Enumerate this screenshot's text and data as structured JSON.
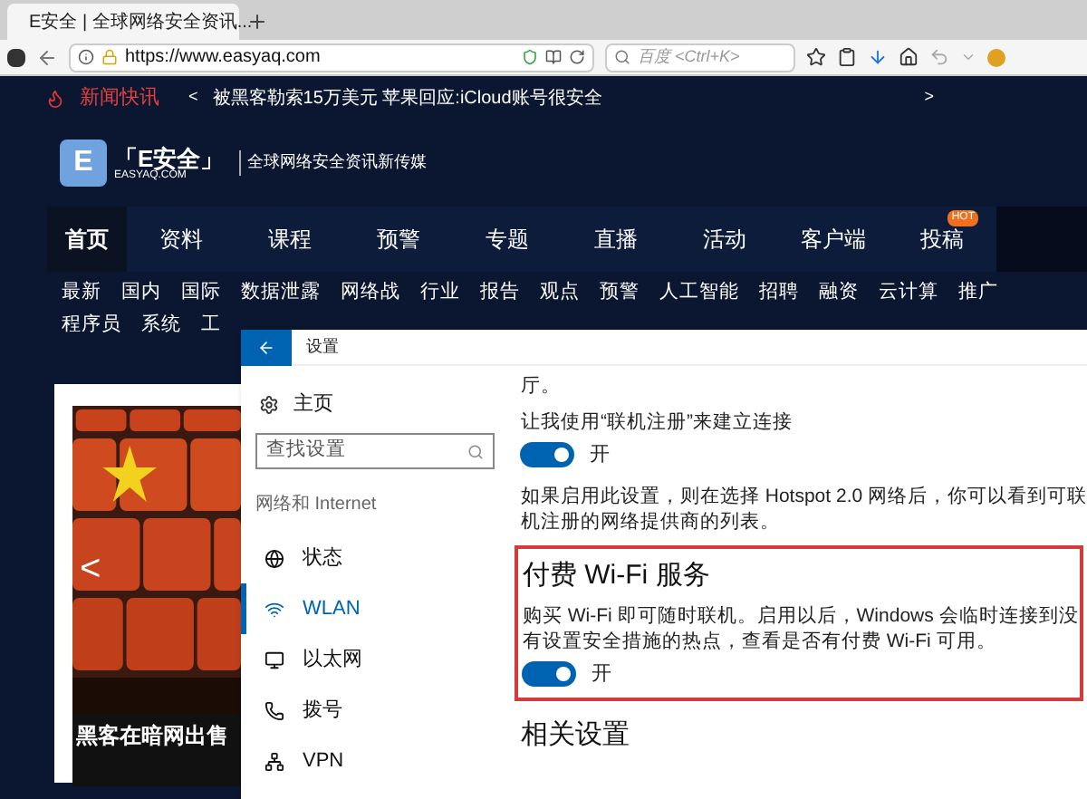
{
  "browser": {
    "tab": {
      "title": "E安全 | 全球网络安全资讯...",
      "selected": true
    },
    "address": "https://www.easyaq.com",
    "search": {
      "placeholder": "百度 <Ctrl+K>"
    }
  },
  "ticker": {
    "label": "新闻快讯",
    "prev": "<",
    "headline": "被黑客勒索15万美元 苹果回应:iCloud账号很安全",
    "next": ">"
  },
  "site": {
    "logo_letter": "E",
    "logo_title": "「E安全」",
    "logo_domain": "EASYAQ.COM",
    "slogan": "全球网络安全资讯新传媒"
  },
  "nav": [
    {
      "label": "首页",
      "selected": true
    },
    {
      "label": "资料",
      "selected": false
    },
    {
      "label": "课程",
      "selected": false
    },
    {
      "label": "预警",
      "selected": false
    },
    {
      "label": "专题",
      "selected": false
    },
    {
      "label": "直播",
      "selected": false
    },
    {
      "label": "活动",
      "selected": false
    },
    {
      "label": "客户端",
      "selected": false
    },
    {
      "label": "投稿",
      "selected": false,
      "badge": "HOT"
    }
  ],
  "subnav_rows": [
    [
      "最新",
      "国内",
      "国际",
      "数据泄露",
      "网络战",
      "行业",
      "报告",
      "观点",
      "预警",
      "人工智能",
      "招聘",
      "融资",
      "云计算",
      "推广"
    ],
    [
      "程序员",
      "系统",
      "工"
    ]
  ],
  "slide": {
    "kind": "picture",
    "prev": "<",
    "headline": "黑客在暗网出售"
  },
  "settings": {
    "title": "设置",
    "home": "主页",
    "search": {
      "placeholder": "查找设置"
    },
    "section": "网络和 Internet",
    "items": [
      {
        "label": "状态",
        "selected": false
      },
      {
        "label": "WLAN",
        "selected": true
      },
      {
        "label": "以太网",
        "selected": false
      },
      {
        "label": "拨号",
        "selected": false
      },
      {
        "label": "VPN",
        "selected": false
      }
    ],
    "content": [
      {
        "kind": "text",
        "lines": [
          "厅。"
        ]
      },
      {
        "kind": "label",
        "lines": [
          "让我使用“联机注册”来建立连接"
        ]
      },
      {
        "kind": "toggle",
        "on": true,
        "label": "开"
      },
      {
        "kind": "text",
        "lines": [
          "如果启用此设置，则在选择 Hotspot 2.0 网络后，你可以看到可联",
          "机注册的网络提供商的列表。"
        ]
      }
    ],
    "highlight": {
      "heading": "付费 Wi-Fi 服务",
      "lines": [
        "购买 Wi-Fi 即可随时联机。启用以后，Windows 会临时连接到没",
        "有设置安全措施的热点，查看是否有付费 Wi-Fi 可用。"
      ],
      "toggle": {
        "on": true,
        "label": "开"
      }
    },
    "related": "相关设置"
  }
}
